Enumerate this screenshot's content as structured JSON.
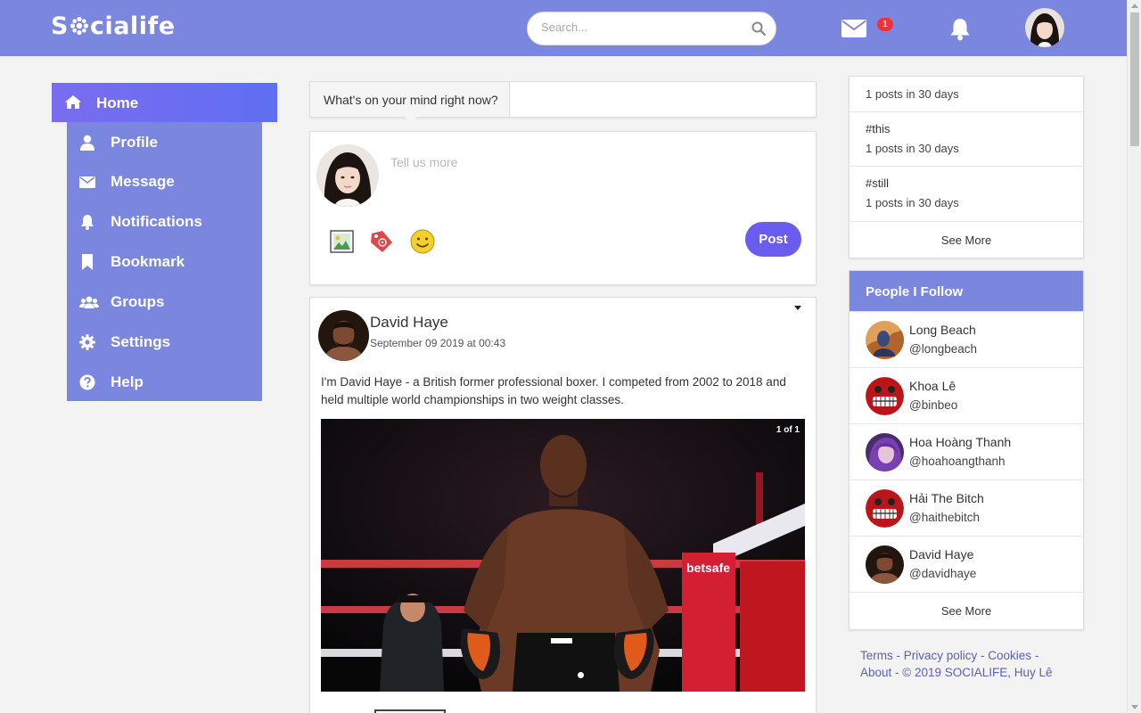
{
  "header": {
    "logo_left": "S",
    "logo_right": "cialife",
    "search_placeholder": "Search...",
    "message_badge": "1"
  },
  "sidebar": {
    "items": [
      {
        "label": "Home",
        "icon": "home-icon",
        "active": true
      },
      {
        "label": "Profile",
        "icon": "user-icon"
      },
      {
        "label": "Message",
        "icon": "envelope-icon"
      },
      {
        "label": "Notifications",
        "icon": "bell-icon"
      },
      {
        "label": "Bookmark",
        "icon": "bookmark-icon"
      },
      {
        "label": "Groups",
        "icon": "users-icon"
      },
      {
        "label": "Settings",
        "icon": "gear-icon"
      },
      {
        "label": "Help",
        "icon": "question-icon"
      }
    ]
  },
  "composer": {
    "prompt": "What's on your mind right now?",
    "placeholder": "Tell us more",
    "post_label": "Post"
  },
  "post": {
    "author": "David Haye",
    "date": "September 09 2019 at 00:43",
    "text": "I'm David Haye - a British former professional boxer. I competed from 2002 to 2018 and held multiple world championships in two weight classes.",
    "photo_counter": "1 of 1"
  },
  "trends": {
    "top_count": "1 posts in 30 days",
    "items": [
      {
        "tag": "#this",
        "count": "1 posts in 30 days"
      },
      {
        "tag": "#still",
        "count": "1 posts in 30 days"
      }
    ],
    "see_more": "See More"
  },
  "follow": {
    "title": "People I Follow",
    "people": [
      {
        "name": "Long Beach",
        "handle": "@longbeach"
      },
      {
        "name": "Khoa Lê",
        "handle": "@binbeo"
      },
      {
        "name": "Hoa Hoàng Thanh",
        "handle": "@hoahoangthanh"
      },
      {
        "name": "Hải The Bitch",
        "handle": "@haithebitch"
      },
      {
        "name": "David Haye",
        "handle": "@davidhaye"
      }
    ],
    "see_more": "See More"
  },
  "footer": {
    "terms": "Terms",
    "privacy": "Privacy policy",
    "cookies": "Cookies",
    "about": "About",
    "copyright": "© 2019 SOCIALIFE, Huy Lê"
  },
  "colors": {
    "brand": "#7b86de",
    "accent": "#6b5cf0",
    "badge": "#e33333"
  }
}
